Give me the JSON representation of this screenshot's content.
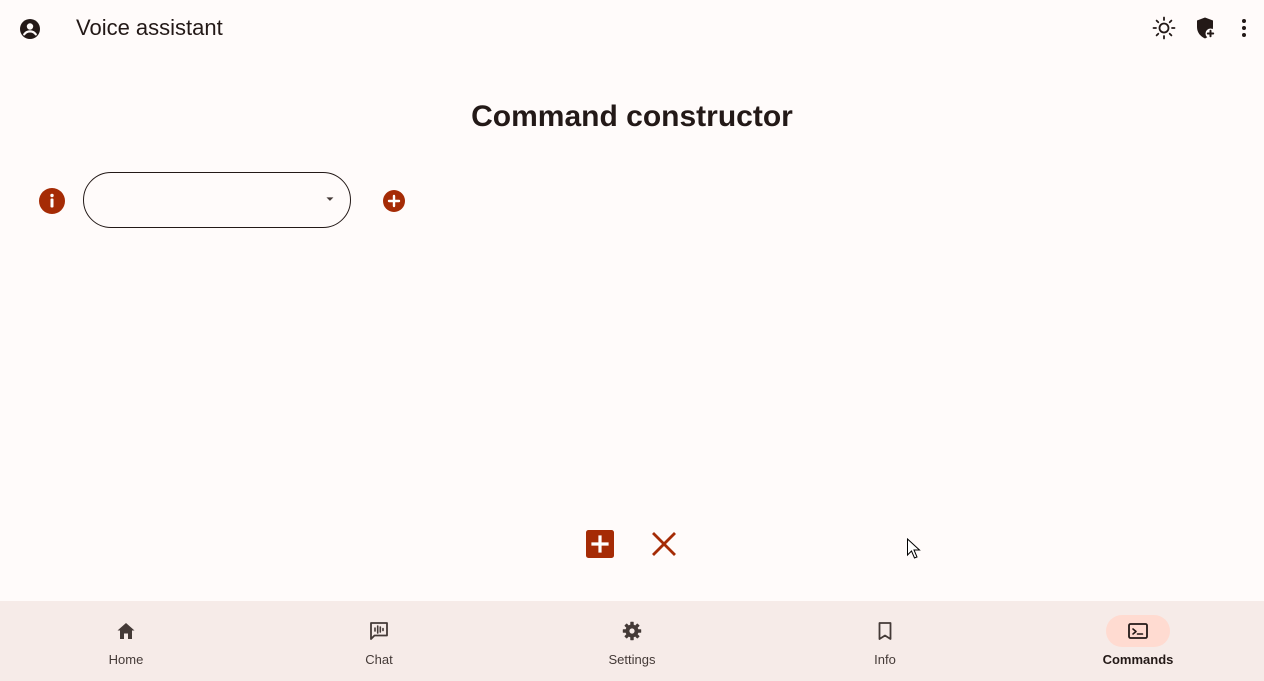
{
  "colors": {
    "accent": "#a52b05",
    "background": "#fffbfa",
    "nav_background": "#f6ebe8",
    "nav_active_pill": "#ffdbd1",
    "text": "#231917"
  },
  "appbar": {
    "title": "Voice assistant",
    "icons": [
      "account-circle-icon",
      "brightness-icon",
      "add-moderator-icon",
      "more-vert-icon"
    ]
  },
  "main": {
    "title": "Command constructor",
    "dropdown": {
      "value": ""
    },
    "row_icons": [
      "info-icon",
      "add-circle-icon"
    ],
    "action_icons": [
      "add-box-icon",
      "close-icon"
    ]
  },
  "nav": {
    "items": [
      {
        "label": "Home",
        "icon": "home-icon",
        "active": false
      },
      {
        "label": "Chat",
        "icon": "chat-voice-icon",
        "active": false
      },
      {
        "label": "Settings",
        "icon": "gear-icon",
        "active": false
      },
      {
        "label": "Info",
        "icon": "bookmark-icon",
        "active": false
      },
      {
        "label": "Commands",
        "icon": "terminal-icon",
        "active": true
      }
    ]
  }
}
